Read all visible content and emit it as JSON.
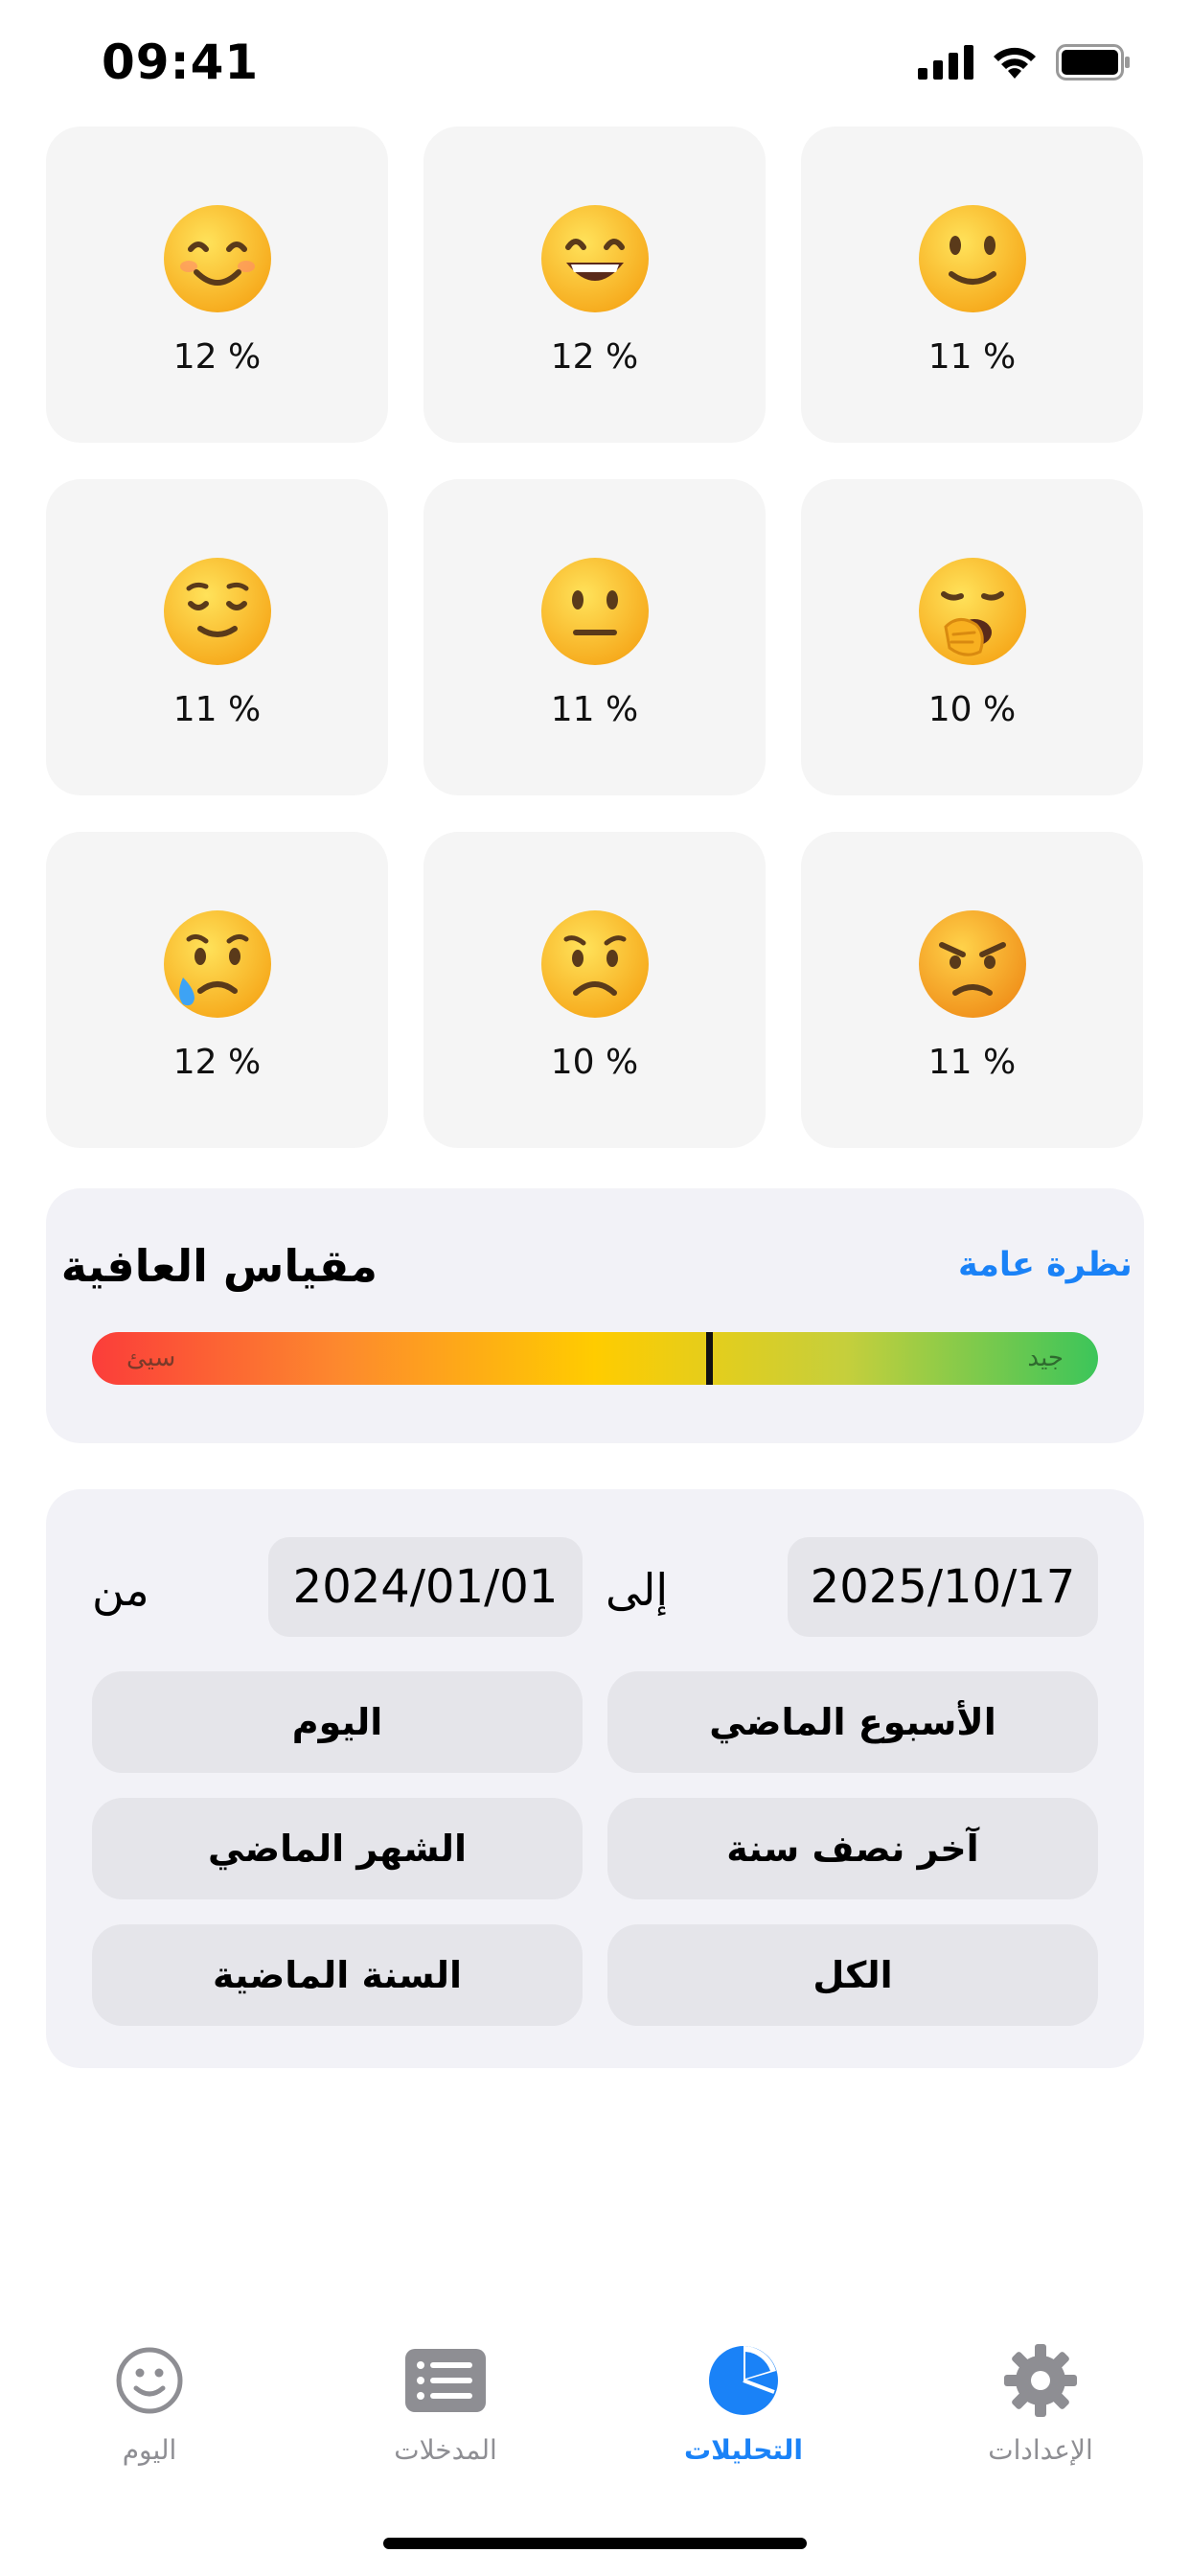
{
  "status": {
    "time": "09:41",
    "icons": [
      "cellular-signal-icon",
      "wifi-icon",
      "battery-icon"
    ]
  },
  "moods": [
    {
      "emoji": "smiling-face-icon",
      "percent": "12 %"
    },
    {
      "emoji": "grinning-face-icon",
      "percent": "12 %"
    },
    {
      "emoji": "slightly-smiling-face-icon",
      "percent": "11 %"
    },
    {
      "emoji": "relieved-face-icon",
      "percent": "11 %"
    },
    {
      "emoji": "neutral-face-icon",
      "percent": "11 %"
    },
    {
      "emoji": "yawning-face-icon",
      "percent": "10 %"
    },
    {
      "emoji": "crying-face-icon",
      "percent": "12 %"
    },
    {
      "emoji": "worried-face-icon",
      "percent": "10 %"
    },
    {
      "emoji": "angry-face-icon",
      "percent": "11 %"
    }
  ],
  "wellbeing": {
    "title": "مقياس العافية",
    "overview_link": "نظرة عامة",
    "bad_label": "سيئ",
    "good_label": "جيد",
    "level": 0.61,
    "gradient_colors": [
      "#fb3d3a",
      "#fd8a2d",
      "#ffcc00",
      "#c5cf3c",
      "#3cc55a"
    ]
  },
  "range": {
    "from_label": "من",
    "to_label": "إلى",
    "from_date": "2024/01/01",
    "to_date": "2025/10/17",
    "presets": {
      "today": "اليوم",
      "last_week": "الأسبوع الماضي",
      "last_month": "الشهر الماضي",
      "last_half_year": "آخر نصف سنة",
      "last_year": "السنة الماضية",
      "all": "الكل"
    }
  },
  "tabs": {
    "today": "اليوم",
    "entries": "المدخلات",
    "analytics": "التحليلات",
    "settings": "الإعدادات"
  },
  "accent_color": "#1a82f7"
}
